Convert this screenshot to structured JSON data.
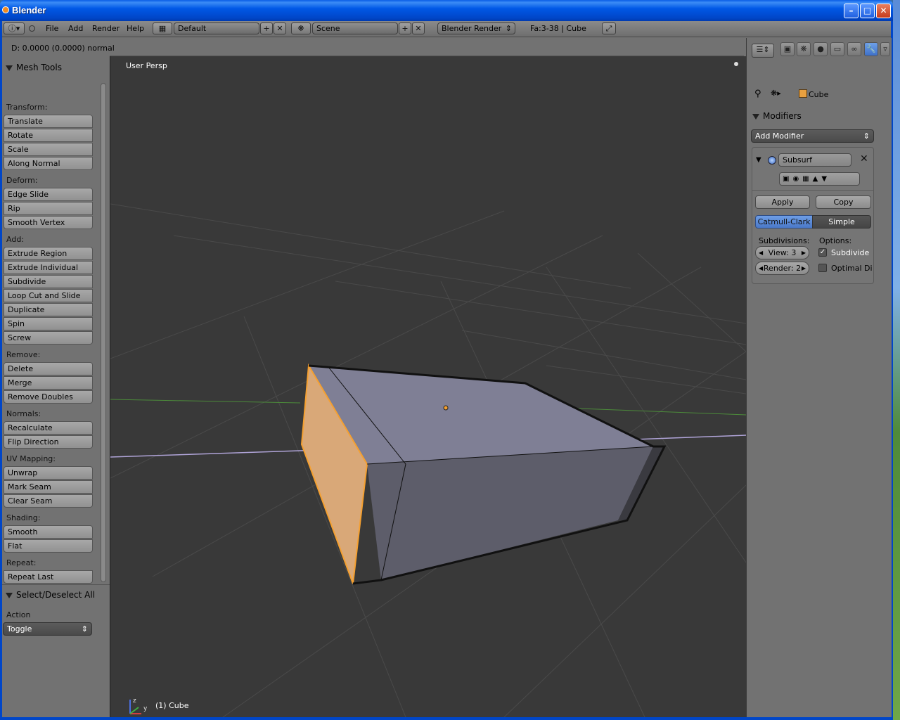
{
  "window": {
    "title": "Blender"
  },
  "menu": {
    "items": [
      "File",
      "Add",
      "Render",
      "Help"
    ]
  },
  "header": {
    "layout": "Default",
    "scene": "Scene",
    "engine": "Blender Render",
    "stats": "Fa:3-38 | Cube"
  },
  "operator_status": "D: 0.0000 (0.0000) normal",
  "toolshelf": {
    "title": "Mesh Tools",
    "groups": [
      {
        "label": "Transform:",
        "buttons": [
          "Translate",
          "Rotate",
          "Scale",
          "Along Normal"
        ]
      },
      {
        "label": "Deform:",
        "buttons": [
          "Edge Slide",
          "Rip",
          "Smooth Vertex"
        ]
      },
      {
        "label": "Add:",
        "buttons": [
          "Extrude Region",
          "Extrude Individual",
          "Subdivide",
          "Loop Cut and Slide",
          "Duplicate",
          "Spin",
          "Screw"
        ]
      },
      {
        "label": "Remove:",
        "buttons": [
          "Delete",
          "Merge",
          "Remove Doubles"
        ]
      },
      {
        "label": "Normals:",
        "buttons": [
          "Recalculate",
          "Flip Direction"
        ]
      },
      {
        "label": "UV Mapping:",
        "buttons": [
          "Unwrap",
          "Mark Seam",
          "Clear Seam"
        ]
      },
      {
        "label": "Shading:",
        "buttons": [
          "Smooth",
          "Flat"
        ]
      },
      {
        "label": "Repeat:",
        "buttons": [
          "Repeat Last"
        ]
      }
    ],
    "operator_panel": {
      "title": "Select/Deselect All",
      "action_label": "Action",
      "action_value": "Toggle"
    }
  },
  "viewport": {
    "view_label": "User Persp",
    "object_label": "(1) Cube",
    "axes": [
      "x",
      "y",
      "z"
    ]
  },
  "properties": {
    "context_object": "Cube",
    "panel_title": "Modifiers",
    "add_modifier": "Add Modifier",
    "modifier": {
      "name": "Subsurf",
      "apply": "Apply",
      "copy": "Copy",
      "type_options": [
        "Catmull-Clark",
        "Simple"
      ],
      "selected_type": "Catmull-Clark",
      "subdivisions_label": "Subdivisions:",
      "options_label": "Options:",
      "view": "View: 3",
      "render": "Render: 2",
      "subdivide_uvs": "Subdivide",
      "subdivide_checked": true,
      "optimal_display": "Optimal Di",
      "optimal_checked": false
    }
  },
  "colors": {
    "viewport_bg": "#393939",
    "selection": "#f5a030",
    "active_tab": "#5680c2",
    "xp_titlebar": "#0058e6"
  }
}
